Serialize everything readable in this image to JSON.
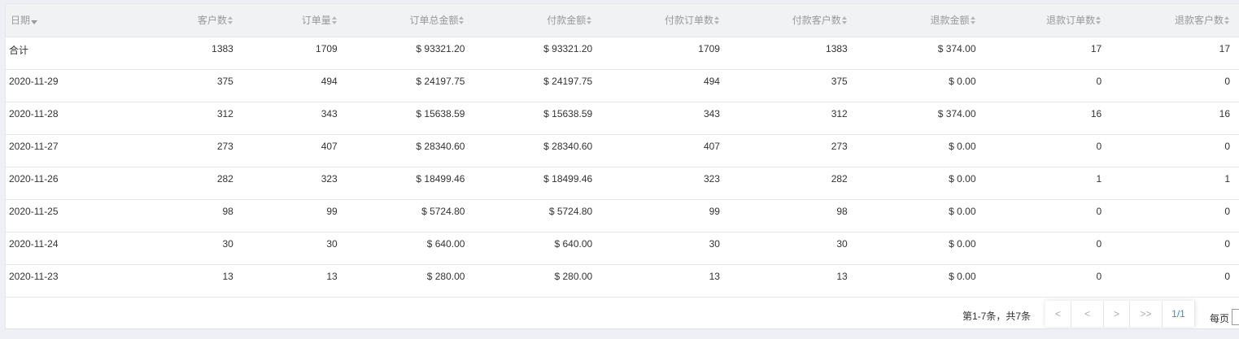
{
  "table": {
    "columns": [
      {
        "label": "日期"
      },
      {
        "label": "客户数"
      },
      {
        "label": "订单量"
      },
      {
        "label": "订单总金额"
      },
      {
        "label": "付款金额"
      },
      {
        "label": "付款订单数"
      },
      {
        "label": "付款客户数"
      },
      {
        "label": "退款金额"
      },
      {
        "label": "退款订单数"
      },
      {
        "label": "退款客户数"
      }
    ],
    "rows": [
      [
        "合计",
        "1383",
        "1709",
        "$ 93321.20",
        "$ 93321.20",
        "1709",
        "1383",
        "$ 374.00",
        "17",
        "17"
      ],
      [
        "2020-11-29",
        "375",
        "494",
        "$ 24197.75",
        "$ 24197.75",
        "494",
        "375",
        "$ 0.00",
        "0",
        "0"
      ],
      [
        "2020-11-28",
        "312",
        "343",
        "$ 15638.59",
        "$ 15638.59",
        "343",
        "312",
        "$ 374.00",
        "16",
        "16"
      ],
      [
        "2020-11-27",
        "273",
        "407",
        "$ 28340.60",
        "$ 28340.60",
        "407",
        "273",
        "$ 0.00",
        "0",
        "0"
      ],
      [
        "2020-11-26",
        "282",
        "323",
        "$ 18499.46",
        "$ 18499.46",
        "323",
        "282",
        "$ 0.00",
        "1",
        "1"
      ],
      [
        "2020-11-25",
        "98",
        "99",
        "$ 5724.80",
        "$ 5724.80",
        "99",
        "98",
        "$ 0.00",
        "0",
        "0"
      ],
      [
        "2020-11-24",
        "30",
        "30",
        "$ 640.00",
        "$ 640.00",
        "30",
        "30",
        "$ 0.00",
        "0",
        "0"
      ],
      [
        "2020-11-23",
        "13",
        "13",
        "$ 280.00",
        "$ 280.00",
        "13",
        "13",
        "$ 0.00",
        "0",
        "0"
      ]
    ]
  },
  "pagination": {
    "info": "第1-7条，共7条",
    "first": "<",
    "prev": "<",
    "next": ">",
    "last": ">>",
    "current": "1/1",
    "per_page_label": "每页"
  },
  "colors": {
    "header_bg": "#f1f2f4",
    "header_text": "#999999",
    "accent": "#2d8cf0"
  }
}
